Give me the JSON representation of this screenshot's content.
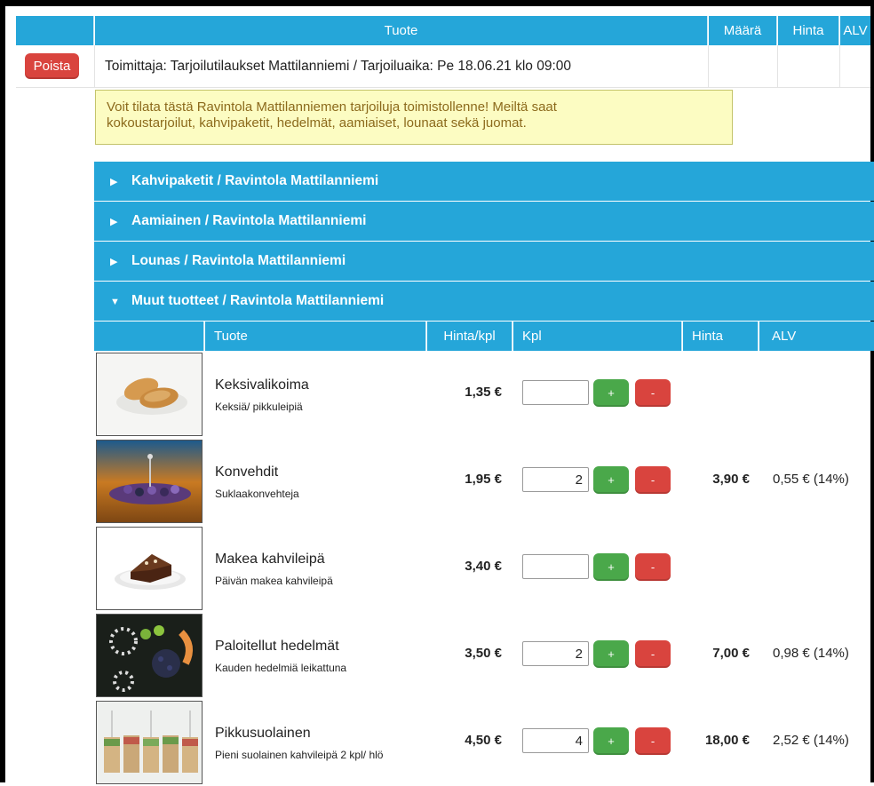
{
  "header": {
    "col_product": "Tuote",
    "col_quantity": "Määrä",
    "col_price": "Hinta",
    "col_vat": "ALV"
  },
  "supplier": {
    "remove_label": "Poista",
    "text": "Toimittaja: Tarjoilutilaukset Mattilanniemi / Tarjoiluaika: Pe 18.06.21 klo 09:00"
  },
  "info": {
    "line1": "Voit tilata tästä Ravintola Mattilanniemen tarjoiluja toimistollenne! Meiltä saat",
    "line2": "kokoustarjoilut, kahvipaketit, hedelmät, aamiaiset, lounaat sekä juomat."
  },
  "categories": [
    {
      "label": "Kahvipaketit / Ravintola Mattilanniemi",
      "expanded": false
    },
    {
      "label": "Aamiainen / Ravintola Mattilanniemi",
      "expanded": false
    },
    {
      "label": "Lounas / Ravintola Mattilanniemi",
      "expanded": false
    },
    {
      "label": "Muut tuotteet / Ravintola Mattilanniemi",
      "expanded": true
    }
  ],
  "product_header": {
    "col_product": "Tuote",
    "col_unit_price": "Hinta/kpl",
    "col_pcs": "Kpl",
    "col_price": "Hinta",
    "col_vat": "ALV"
  },
  "buttons": {
    "plus": "+",
    "minus": "-"
  },
  "products": [
    {
      "name": "Keksivalikoima",
      "desc": "Keksiä/ pikkuleipiä",
      "unit_price": "1,35 €",
      "qty": "",
      "total": "",
      "vat": ""
    },
    {
      "name": "Konvehdit",
      "desc": "Suklaakonvehteja",
      "unit_price": "1,95 €",
      "qty": "2",
      "total": "3,90 €",
      "vat": "0,55 € (14%)"
    },
    {
      "name": "Makea kahvileipä",
      "desc": "Päivän makea kahvileipä",
      "unit_price": "3,40 €",
      "qty": "",
      "total": "",
      "vat": ""
    },
    {
      "name": "Paloitellut hedelmät",
      "desc": "Kauden hedelmiä leikattuna",
      "unit_price": "3,50 €",
      "qty": "2",
      "total": "7,00 €",
      "vat": "0,98 € (14%)"
    },
    {
      "name": "Pikkusuolainen",
      "desc": "Pieni suolainen kahvileipä 2 kpl/ hlö",
      "unit_price": "4,50 €",
      "qty": "4",
      "total": "18,00 €",
      "vat": "2,52 € (14%)"
    }
  ],
  "colors": {
    "header_blue": "#25a6d9",
    "remove_red": "#d9443e",
    "add_green": "#4aa84a",
    "info_bg": "#fcfcc2"
  }
}
